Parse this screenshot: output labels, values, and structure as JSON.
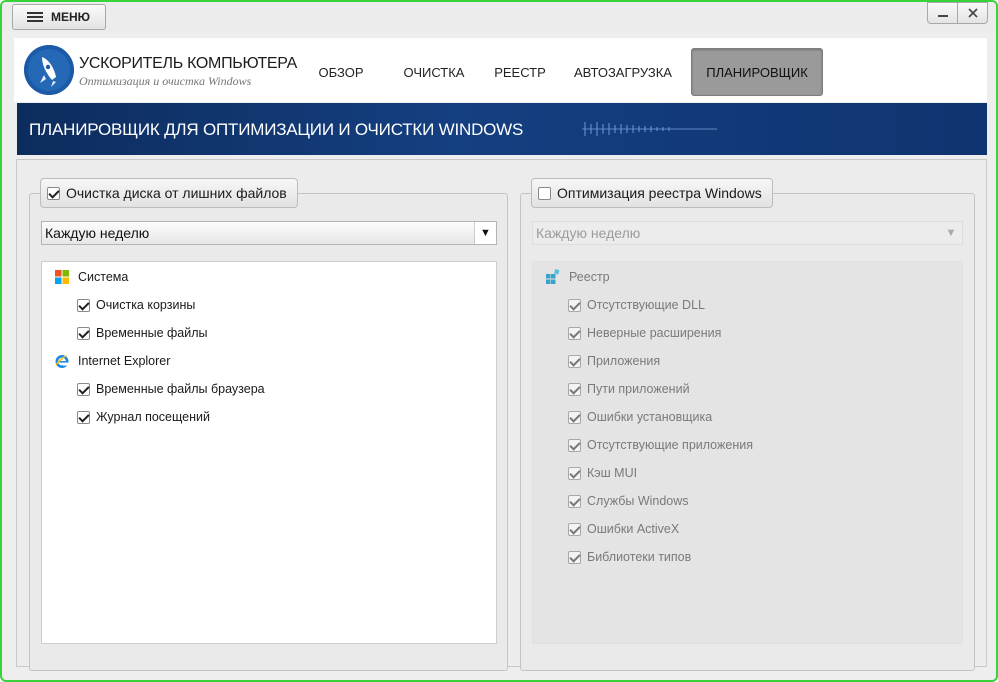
{
  "app": {
    "menu_label": "МЕНЮ",
    "logo_title": "УСКОРИТЕЛЬ КОМПЬЮТЕРА",
    "logo_subtitle": "Оптимизация и очистка Windows"
  },
  "nav": {
    "tabs": [
      {
        "label": "ОБЗОР",
        "active": false
      },
      {
        "label": "ОЧИСТКА",
        "active": false
      },
      {
        "label": "РЕЕСТР",
        "active": false
      },
      {
        "label": "АВТОЗАГРУЗКА",
        "active": false
      },
      {
        "label": "ПЛАНИРОВЩИК",
        "active": true
      }
    ]
  },
  "banner": {
    "title": "ПЛАНИРОВЩИК ДЛЯ ОПТИМИЗАЦИИ И ОЧИСТКИ WINDOWS"
  },
  "left_panel": {
    "title": "Очистка диска от лишних файлов",
    "enabled": true,
    "schedule": "Каждую неделю",
    "groups": [
      {
        "label": "Система",
        "icon": "windows-icon",
        "items": [
          {
            "label": "Очистка корзины",
            "checked": true
          },
          {
            "label": "Временные файлы",
            "checked": true
          }
        ]
      },
      {
        "label": "Internet Explorer",
        "icon": "internet-explorer-icon",
        "items": [
          {
            "label": "Временные файлы браузера",
            "checked": true
          },
          {
            "label": "Журнал посещений",
            "checked": true
          }
        ]
      }
    ]
  },
  "right_panel": {
    "title": "Оптимизация реестра Windows",
    "enabled": false,
    "schedule": "Каждую неделю",
    "group_label": "Реестр",
    "group_icon": "registry-icon",
    "items": [
      {
        "label": "Отсутствующие DLL",
        "checked": true
      },
      {
        "label": "Неверные расширения",
        "checked": true
      },
      {
        "label": "Приложения",
        "checked": true
      },
      {
        "label": "Пути приложений",
        "checked": true
      },
      {
        "label": "Ошибки установщика",
        "checked": true
      },
      {
        "label": "Отсутствующие приложения",
        "checked": true
      },
      {
        "label": "Кэш MUI",
        "checked": true
      },
      {
        "label": "Службы Windows",
        "checked": true
      },
      {
        "label": "Ошибки ActiveX",
        "checked": true
      },
      {
        "label": "Библиотеки типов",
        "checked": true
      }
    ]
  },
  "colors": {
    "window_border": "#3ad23a",
    "banner_dark": "#0d2c5e",
    "banner_mid": "#143f80",
    "logo_blue": "#1b5aa7",
    "active_tab": "#9a9a9a"
  }
}
